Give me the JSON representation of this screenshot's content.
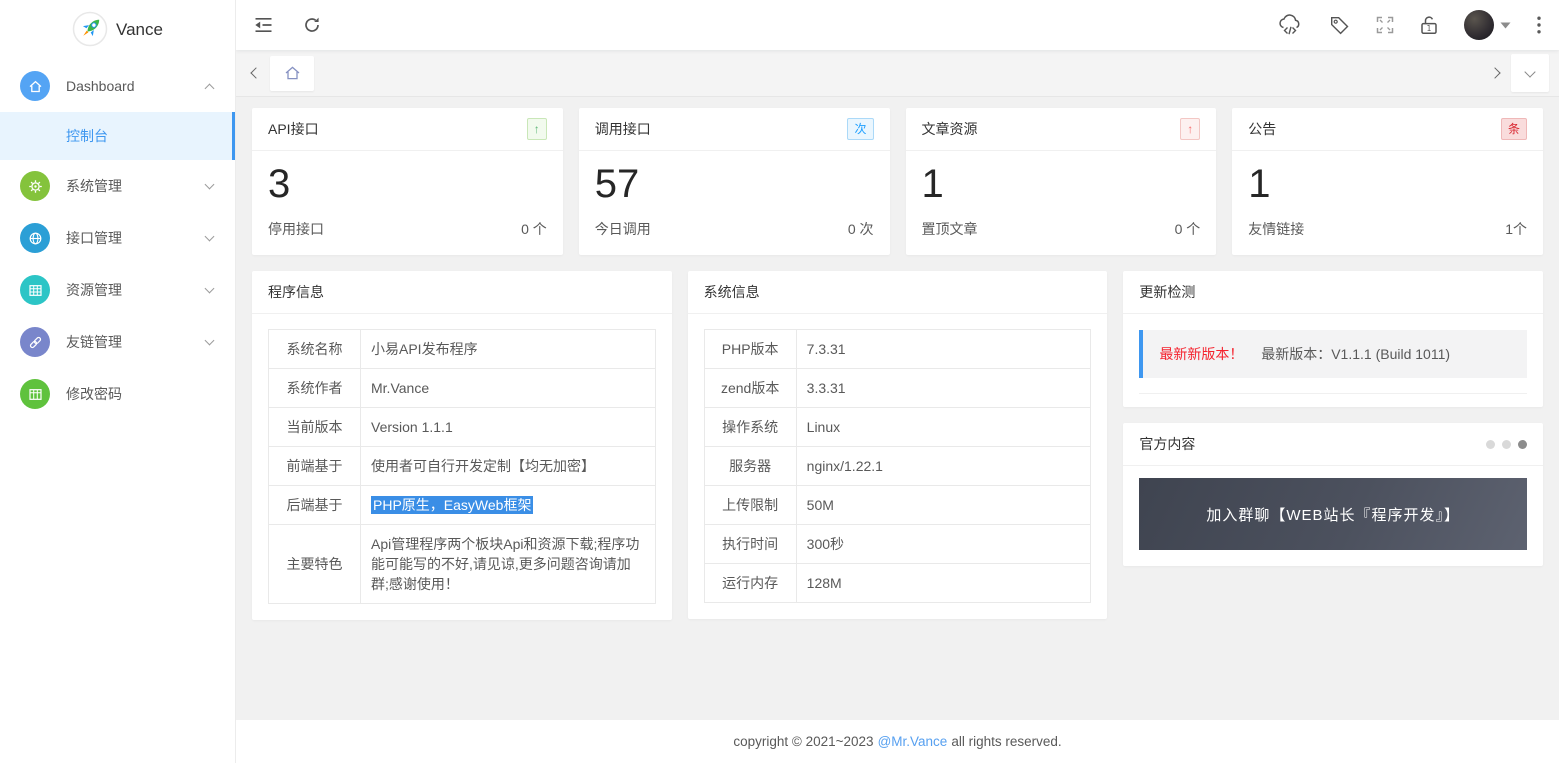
{
  "brand": {
    "name": "Vance"
  },
  "sidebar": {
    "items": [
      {
        "label": "Dashboard"
      },
      {
        "label": "控制台"
      },
      {
        "label": "系统管理"
      },
      {
        "label": "接口管理"
      },
      {
        "label": "资源管理"
      },
      {
        "label": "友链管理"
      },
      {
        "label": "修改密码"
      }
    ]
  },
  "stat_cards": [
    {
      "title": "API接口",
      "badge": "↑",
      "value": "3",
      "footer_label": "停用接口",
      "footer_value": "0 个"
    },
    {
      "title": "调用接口",
      "badge": "次",
      "value": "57",
      "footer_label": "今日调用",
      "footer_value": "0 次"
    },
    {
      "title": "文章资源",
      "badge": "↑",
      "value": "1",
      "footer_label": "置顶文章",
      "footer_value": "0 个"
    },
    {
      "title": "公告",
      "badge": "条",
      "value": "1",
      "footer_label": "友情链接",
      "footer_value": "1个"
    }
  ],
  "program_info": {
    "title": "程序信息",
    "rows": [
      {
        "label": "系统名称",
        "value": "小易API发布程序"
      },
      {
        "label": "系统作者",
        "value": "Mr.Vance"
      },
      {
        "label": "当前版本",
        "value": "Version 1.1.1"
      },
      {
        "label": "前端基于",
        "value": "使用者可自行开发定制【均无加密】"
      },
      {
        "label": "后端基于",
        "value": "PHP原生，EasyWeb框架"
      },
      {
        "label": "主要特色",
        "value": "Api管理程序两个板块Api和资源下载;程序功能可能写的不好,请见谅,更多问题咨询请加群;感谢使用！"
      }
    ]
  },
  "system_info": {
    "title": "系统信息",
    "rows": [
      {
        "label": "PHP版本",
        "value": "7.3.31"
      },
      {
        "label": "zend版本",
        "value": "3.3.31"
      },
      {
        "label": "操作系统",
        "value": "Linux"
      },
      {
        "label": "服务器",
        "value": "nginx/1.22.1"
      },
      {
        "label": "上传限制",
        "value": "50M"
      },
      {
        "label": "执行时间",
        "value": "300秒"
      },
      {
        "label": "运行内存",
        "value": "128M"
      }
    ]
  },
  "update_check": {
    "title": "更新检测",
    "alert_highlight": "最新新版本！",
    "alert_text": "最新版本：V1.1.1 (Build 1011)"
  },
  "official": {
    "title": "官方内容",
    "banner_text": "加入群聊【WEB站长『程序开发』】"
  },
  "footer": {
    "text_before": "copyright © 2021~2023",
    "link": "@Mr.Vance",
    "text_after": "all rights reserved."
  },
  "colors": {
    "accent_blue": "#3e97f0",
    "badge_green": "#5fb878",
    "badge_blue": "#1e9fff",
    "badge_red": "#f56c6c",
    "icon_dashboard": "#54a4f4",
    "icon_system": "#84c33c",
    "icon_api": "#2b9fd6",
    "icon_resource": "#2cc5c6",
    "icon_links": "#7986cb",
    "icon_password": "#5fc23d",
    "banner_bg": "#4c515e",
    "selection_highlight": "#3a8ee6"
  }
}
